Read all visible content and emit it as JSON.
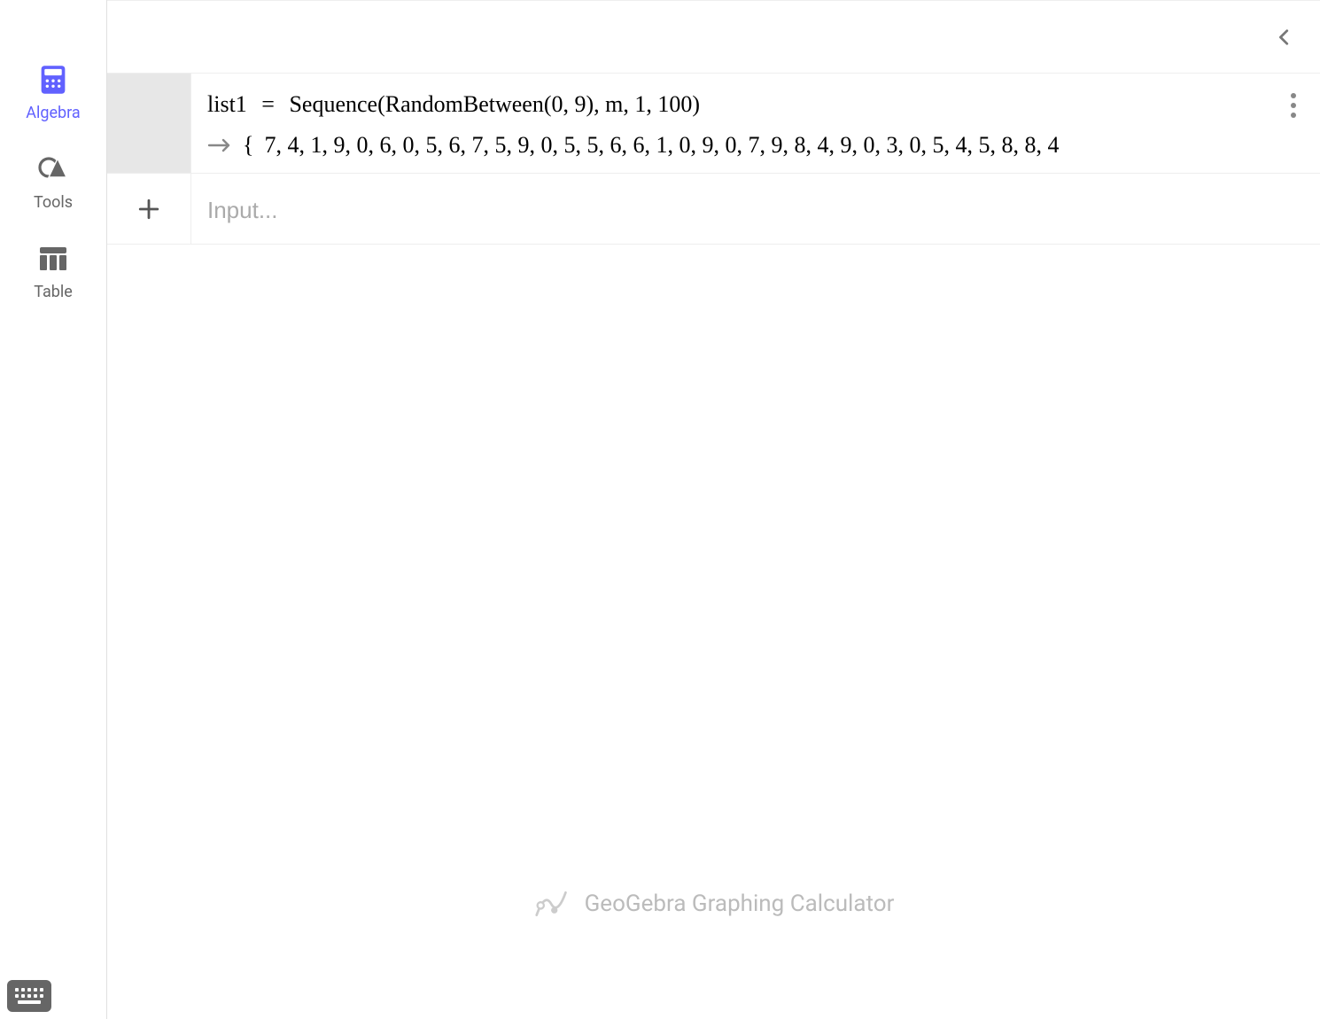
{
  "sidebar": {
    "items": [
      {
        "label": "Algebra"
      },
      {
        "label": "Tools"
      },
      {
        "label": "Table"
      }
    ]
  },
  "entry": {
    "name": "list1",
    "equals": "=",
    "expression": "Sequence(RandomBetween(0, 9), m, 1, 100)",
    "output_prefix": "{",
    "output_values": "7, 4, 1, 9, 0, 6, 0, 5, 6, 7, 5, 9, 0, 5, 5, 6, 6, 1, 0, 9, 0, 7, 9, 8, 4, 9, 0, 3, 0, 5, 4, 5, 8, 8, 4"
  },
  "input": {
    "placeholder": "Input..."
  },
  "footer": {
    "brand": "GeoGebra Graphing Calculator"
  }
}
